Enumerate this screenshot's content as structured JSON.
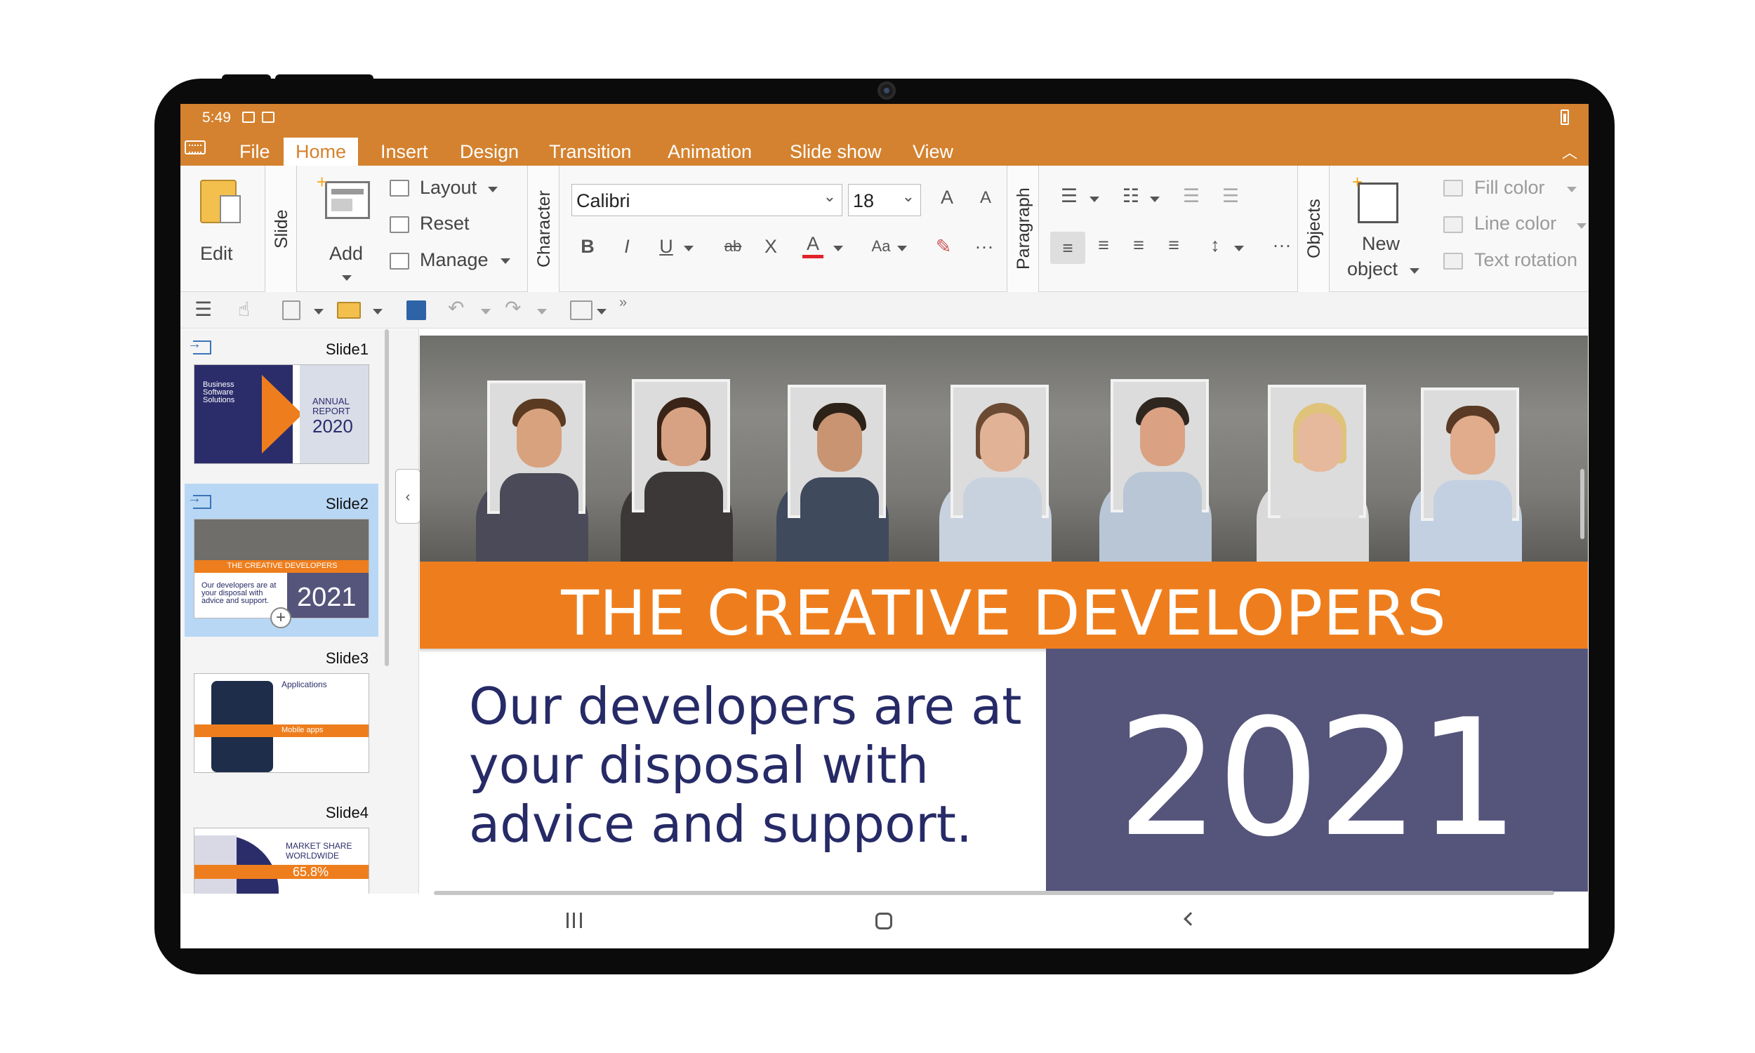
{
  "status_bar": {
    "time": "5:49"
  },
  "menu": {
    "tabs": [
      {
        "label": "File"
      },
      {
        "label": "Home",
        "active": true
      },
      {
        "label": "Insert"
      },
      {
        "label": "Design"
      },
      {
        "label": "Transition"
      },
      {
        "label": "Animation"
      },
      {
        "label": "Slide show"
      },
      {
        "label": "View"
      }
    ]
  },
  "ribbon": {
    "edit_label": "Edit",
    "slide_group": "Slide",
    "add_label": "Add",
    "layout_label": "Layout",
    "reset_label": "Reset",
    "manage_label": "Manage",
    "character_group": "Character",
    "font_name": "Calibri",
    "font_size": "18",
    "bold": "B",
    "italic": "I",
    "underline": "U",
    "strikethrough": "ab",
    "clear_format": "X",
    "font_color": "A",
    "case": "Aa",
    "grow_font": "A",
    "shrink_font": "A",
    "more": "···",
    "paragraph_group": "Paragraph",
    "objects_group": "Objects",
    "new_object_line1": "New",
    "new_object_line2": "object",
    "fill_color_label": "Fill color",
    "line_color_label": "Line color",
    "text_rotation_label": "Text rotation"
  },
  "slides": [
    {
      "name": "Slide1",
      "thumb_title1": "Business",
      "thumb_title2": "Software",
      "thumb_title3": "Solutions",
      "thumb_report1": "ANNUAL",
      "thumb_report2": "REPORT",
      "thumb_year": "2020"
    },
    {
      "name": "Slide2",
      "thumb_banner": "THE CREATIVE DEVELOPERS",
      "thumb_text1": "Our developers are at",
      "thumb_text2": "your disposal with",
      "thumb_text3": "advice and support.",
      "thumb_year": "2021",
      "selected": true
    },
    {
      "name": "Slide3",
      "thumb_heading": "Applications",
      "thumb_band": "Mobile apps"
    },
    {
      "name": "Slide4",
      "thumb_heading1": "MARKET SHARE",
      "thumb_heading2": "WORLDWIDE",
      "thumb_value": "65.8%"
    }
  ],
  "main_slide": {
    "title": "THE CREATIVE DEVELOPERS",
    "body_line1": "Our developers are at",
    "body_line2": "your disposal with",
    "body_line3": "advice and support.",
    "year": "2021"
  },
  "colors": {
    "accent": "#d4822f",
    "title_band": "#ee7e1d",
    "year_box": "#55547b",
    "body_text": "#262a66"
  }
}
